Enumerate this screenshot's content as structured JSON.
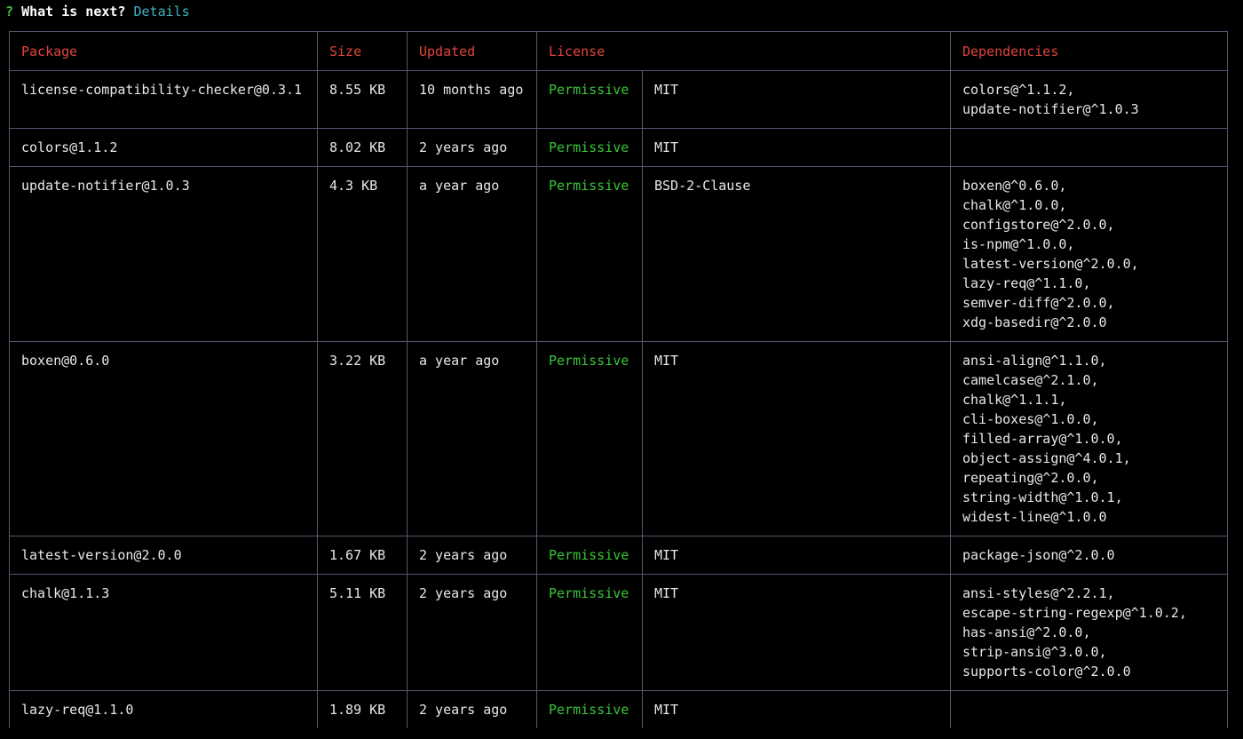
{
  "prompt": {
    "symbol": "?",
    "question": "What is next?",
    "answer": "Details"
  },
  "table": {
    "headers": {
      "package": "Package",
      "size": "Size",
      "updated": "Updated",
      "license": "License",
      "dependencies": "Dependencies"
    },
    "rows": [
      {
        "package": "license-compatibility-checker@0.3.1",
        "size": "8.55 KB",
        "updated": "10 months ago",
        "license_type": "Permissive",
        "license": "MIT",
        "dependencies": [
          "colors@^1.1.2,",
          "update-notifier@^1.0.3"
        ]
      },
      {
        "package": "colors@1.1.2",
        "size": "8.02 KB",
        "updated": "2 years ago",
        "license_type": "Permissive",
        "license": "MIT",
        "dependencies": []
      },
      {
        "package": "update-notifier@1.0.3",
        "size": "4.3 KB",
        "updated": "a year ago",
        "license_type": "Permissive",
        "license": "BSD-2-Clause",
        "dependencies": [
          "boxen@^0.6.0,",
          "chalk@^1.0.0,",
          "configstore@^2.0.0,",
          "is-npm@^1.0.0,",
          "latest-version@^2.0.0,",
          "lazy-req@^1.1.0,",
          "semver-diff@^2.0.0,",
          "xdg-basedir@^2.0.0"
        ]
      },
      {
        "package": "boxen@0.6.0",
        "size": "3.22 KB",
        "updated": "a year ago",
        "license_type": "Permissive",
        "license": "MIT",
        "dependencies": [
          "ansi-align@^1.1.0,",
          "camelcase@^2.1.0,",
          "chalk@^1.1.1,",
          "cli-boxes@^1.0.0,",
          "filled-array@^1.0.0,",
          "object-assign@^4.0.1,",
          "repeating@^2.0.0,",
          "string-width@^1.0.1,",
          "widest-line@^1.0.0"
        ]
      },
      {
        "package": "latest-version@2.0.0",
        "size": "1.67 KB",
        "updated": "2 years ago",
        "license_type": "Permissive",
        "license": "MIT",
        "dependencies": [
          "package-json@^2.0.0"
        ]
      },
      {
        "package": "chalk@1.1.3",
        "size": "5.11 KB",
        "updated": "2 years ago",
        "license_type": "Permissive",
        "license": "MIT",
        "dependencies": [
          "ansi-styles@^2.2.1,",
          "escape-string-regexp@^1.0.2,",
          "has-ansi@^2.0.0,",
          "strip-ansi@^3.0.0,",
          "supports-color@^2.0.0"
        ]
      },
      {
        "package": "lazy-req@1.1.0",
        "size": "1.89 KB",
        "updated": "2 years ago",
        "license_type": "Permissive",
        "license": "MIT",
        "dependencies": []
      }
    ]
  },
  "colors": {
    "background": "#000000",
    "header_text": "#e0443b",
    "permissive": "#39c539",
    "border": "#5a5470",
    "prompt_symbol": "#3fbf3f",
    "prompt_answer": "#3fb3c0"
  }
}
